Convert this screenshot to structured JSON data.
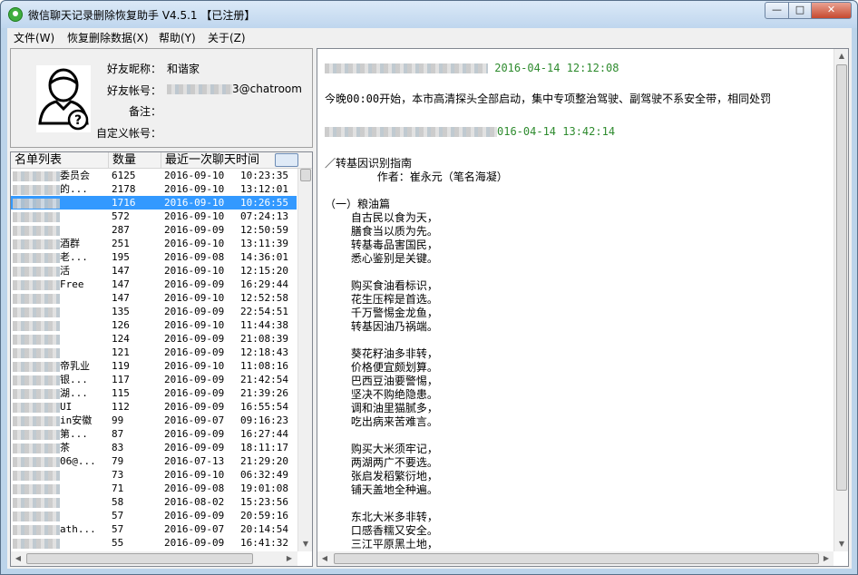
{
  "window": {
    "title": "微信聊天记录删除恢复助手 V4.5.1 【已注册】",
    "min": "—",
    "max": "□",
    "close": "✕"
  },
  "menu": [
    "文件(W)",
    "恢复删除数据(X)",
    "帮助(Y)",
    "关于(Z)"
  ],
  "profile": {
    "nickname_label": "好友昵称：",
    "nickname": "和谐家",
    "account_label": "好友帐号：",
    "account_suffix": "3@chatroom",
    "note_label": "备注：",
    "note": "",
    "custom_label": "自定义帐号：",
    "custom": ""
  },
  "contacts": {
    "columns": [
      "名单列表",
      "数量",
      "最近一次聊天时间"
    ],
    "rows": [
      {
        "name": "委员会",
        "count": "6125",
        "date": "2016-09-10",
        "time": "10:23:35"
      },
      {
        "name": "的...",
        "count": "2178",
        "date": "2016-09-10",
        "time": "13:12:01"
      },
      {
        "name": "",
        "count": "1716",
        "date": "2016-09-10",
        "time": "10:26:55",
        "selected": true
      },
      {
        "name": "",
        "count": "572",
        "date": "2016-09-10",
        "time": "07:24:13"
      },
      {
        "name": "",
        "count": "287",
        "date": "2016-09-09",
        "time": "12:50:59"
      },
      {
        "name": "酒群",
        "count": "251",
        "date": "2016-09-10",
        "time": "13:11:39"
      },
      {
        "name": "老...",
        "count": "195",
        "date": "2016-09-08",
        "time": "14:36:01"
      },
      {
        "name": "活",
        "count": "147",
        "date": "2016-09-10",
        "time": "12:15:20"
      },
      {
        "name": "Free",
        "count": "147",
        "date": "2016-09-09",
        "time": "16:29:44"
      },
      {
        "name": "",
        "count": "147",
        "date": "2016-09-10",
        "time": "12:52:58"
      },
      {
        "name": "",
        "count": "135",
        "date": "2016-09-09",
        "time": "22:54:51"
      },
      {
        "name": "",
        "count": "126",
        "date": "2016-09-10",
        "time": "11:44:38"
      },
      {
        "name": "",
        "count": "124",
        "date": "2016-09-09",
        "time": "21:08:39"
      },
      {
        "name": "",
        "count": "121",
        "date": "2016-09-09",
        "time": "12:18:43"
      },
      {
        "name": "帝乳业",
        "count": "119",
        "date": "2016-09-10",
        "time": "11:08:16"
      },
      {
        "name": "银...",
        "count": "117",
        "date": "2016-09-09",
        "time": "21:42:54"
      },
      {
        "name": "湖...",
        "count": "115",
        "date": "2016-09-09",
        "time": "21:39:26"
      },
      {
        "name": "UI",
        "count": "112",
        "date": "2016-09-09",
        "time": "16:55:54"
      },
      {
        "name": "in安徽",
        "count": "99",
        "date": "2016-09-07",
        "time": "09:16:23"
      },
      {
        "name": "第...",
        "count": "87",
        "date": "2016-09-09",
        "time": "16:27:44"
      },
      {
        "name": "茶",
        "count": "83",
        "date": "2016-09-09",
        "time": "18:11:17"
      },
      {
        "name": "06@...",
        "count": "79",
        "date": "2016-07-13",
        "time": "21:29:20"
      },
      {
        "name": "",
        "count": "73",
        "date": "2016-09-10",
        "time": "06:32:49"
      },
      {
        "name": "",
        "count": "71",
        "date": "2016-09-08",
        "time": "19:01:08"
      },
      {
        "name": "",
        "count": "58",
        "date": "2016-08-02",
        "time": "15:23:56"
      },
      {
        "name": "",
        "count": "57",
        "date": "2016-09-09",
        "time": "20:59:16"
      },
      {
        "name": "ath...",
        "count": "57",
        "date": "2016-09-07",
        "time": "20:14:54"
      },
      {
        "name": "",
        "count": "55",
        "date": "2016-09-09",
        "time": "16:41:32"
      }
    ]
  },
  "messages": {
    "date1": "2016-04-14 12:12:08",
    "line1": "今晚00:00开始，本市高清探头全部启动，集中专项整治驾驶、副驾驶不系安全带，相同处罚",
    "date2": "016-04-14 13:42:14",
    "body": "／转基因识别指南\n        作者：崔永元（笔名海凝）\n\n（一）粮油篇\n    自古民以食为天，\n    膳食当以质为先。\n    转基毒品害国民，\n    悉心鉴别是关键。\n\n    购买食油看标识，\n    花生压榨是首选。\n    千万警惕金龙鱼，\n    转基因油乃祸端。\n\n    葵花籽油多非转，\n    价格便宜颇划算。\n    巴西豆油要警惕，\n    坚决不购绝隐患。\n    调和油里猫腻多，\n    吃出病来苦难言。\n\n    购买大米须牢记，\n    两湖两广不要选。\n    张启发稻繁衍地，\n    铺天盖地全种遍。\n\n    东北大米多非转，\n    口感香糯又安全。\n    三江平原黑土地，"
  }
}
